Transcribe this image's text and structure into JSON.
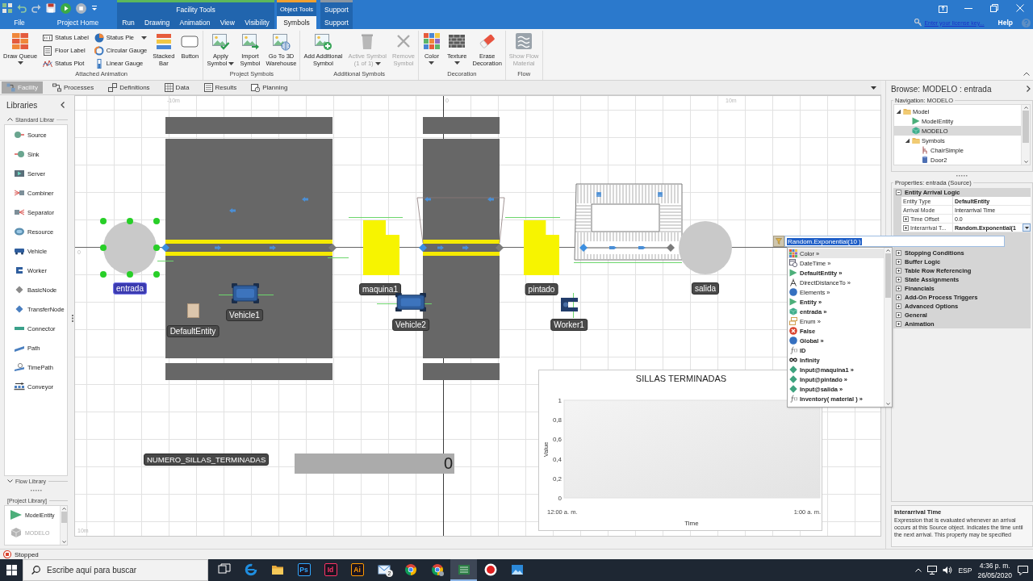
{
  "title_bar": {
    "tabs": [
      {
        "label": "File",
        "selected": false
      },
      {
        "label": "Project Home",
        "selected": false
      }
    ],
    "context_groups": [
      {
        "label": "Facility Tools",
        "color": "#5cb85c",
        "tabs": [
          {
            "label": "Run",
            "selected": false
          },
          {
            "label": "Drawing",
            "selected": false
          },
          {
            "label": "Animation",
            "selected": false
          },
          {
            "label": "View",
            "selected": false
          },
          {
            "label": "Visibility",
            "selected": false
          }
        ]
      },
      {
        "label": "Object Tools",
        "color": "#f0a030",
        "tabs": [
          {
            "label": "Symbols",
            "selected": true
          }
        ]
      },
      {
        "label": "Support",
        "color": "#8a96a3",
        "tabs": [
          {
            "label": "Support",
            "selected": false
          }
        ]
      }
    ],
    "license_link": "Enter your license key...",
    "help": "Help"
  },
  "ribbon": {
    "groups": [
      {
        "label": "Attached Animation",
        "items": [
          {
            "label": "Draw Queue",
            "kind": "large",
            "dropdown": true,
            "disabled": false
          },
          {
            "label": "Status Label",
            "kind": "small",
            "dropdown": false,
            "disabled": false
          },
          {
            "label": "Floor Label",
            "kind": "small",
            "dropdown": false,
            "disabled": false
          },
          {
            "label": "Status Plot",
            "kind": "small",
            "dropdown": false,
            "disabled": false
          },
          {
            "label": "Status Pie",
            "kind": "small",
            "dropdown": true,
            "disabled": false
          },
          {
            "label": "Circular Gauge",
            "kind": "small",
            "dropdown": false,
            "disabled": false
          },
          {
            "label": "Linear Gauge",
            "kind": "small",
            "dropdown": false,
            "disabled": false
          },
          {
            "label": "Stacked\nBar",
            "kind": "large",
            "dropdown": false,
            "disabled": false
          },
          {
            "label": "Button",
            "kind": "large",
            "dropdown": false,
            "disabled": false
          }
        ]
      },
      {
        "label": "Project Symbols",
        "items": [
          {
            "label": "Apply\nSymbol",
            "kind": "large",
            "dropdown": true,
            "disabled": false
          },
          {
            "label": "Import\nSymbol",
            "kind": "large",
            "dropdown": false,
            "disabled": false
          },
          {
            "label": "Go To 3D\nWarehouse",
            "kind": "large",
            "dropdown": false,
            "disabled": false
          }
        ]
      },
      {
        "label": "Additional Symbols",
        "items": [
          {
            "label": "Add Additional\nSymbol",
            "kind": "large",
            "dropdown": false,
            "disabled": false
          },
          {
            "label": "Active Symbol\n(1 of 1)",
            "kind": "large",
            "dropdown": true,
            "disabled": true
          },
          {
            "label": "Remove\nSymbol",
            "kind": "large",
            "dropdown": false,
            "disabled": true
          }
        ]
      },
      {
        "label": "Decoration",
        "items": [
          {
            "label": "Color",
            "kind": "large",
            "dropdown": true,
            "disabled": false
          },
          {
            "label": "Texture",
            "kind": "large",
            "dropdown": true,
            "disabled": false
          },
          {
            "label": "Erase\nDecoration",
            "kind": "large",
            "dropdown": false,
            "disabled": false
          }
        ]
      },
      {
        "label": "Flow",
        "items": [
          {
            "label": "Show Flow\nMaterial",
            "kind": "large",
            "dropdown": false,
            "disabled": true
          }
        ]
      }
    ]
  },
  "view_tabs": [
    {
      "label": "Facility",
      "selected": true
    },
    {
      "label": "Processes",
      "selected": false
    },
    {
      "label": "Definitions",
      "selected": false
    },
    {
      "label": "Data",
      "selected": false
    },
    {
      "label": "Results",
      "selected": false
    },
    {
      "label": "Planning",
      "selected": false
    }
  ],
  "libraries": {
    "title": "Libraries",
    "groups": [
      {
        "title": "Standard Librar",
        "expanded": true,
        "items": [
          {
            "label": "Source",
            "kind": "source"
          },
          {
            "label": "Sink",
            "kind": "sink"
          },
          {
            "label": "Server",
            "kind": "server"
          },
          {
            "label": "Combiner",
            "kind": "combiner"
          },
          {
            "label": "Separator",
            "kind": "separator"
          },
          {
            "label": "Resource",
            "kind": "resource"
          },
          {
            "label": "Vehicle",
            "kind": "vehicle"
          },
          {
            "label": "Worker",
            "kind": "worker"
          },
          {
            "label": "BasicNode",
            "kind": "basicnode"
          },
          {
            "label": "TransferNode",
            "kind": "transfernode"
          },
          {
            "label": "Connector",
            "kind": "connector"
          },
          {
            "label": "Path",
            "kind": "path"
          },
          {
            "label": "TimePath",
            "kind": "timepath"
          },
          {
            "label": "Conveyor",
            "kind": "conveyor"
          }
        ]
      },
      {
        "title": "Flow Library",
        "expanded": false
      }
    ],
    "project": {
      "title": "[Project Library]",
      "items": [
        {
          "label": "ModelEntity",
          "kind": "entity",
          "disabled": false
        },
        {
          "label": "MODELO",
          "kind": "model",
          "disabled": true
        }
      ]
    }
  },
  "canvas": {
    "ruler_labels": [
      "-10m",
      "0",
      "10m",
      "0",
      "10m"
    ],
    "objects": [
      {
        "kind": "source",
        "label": "entrada",
        "selected": true
      },
      {
        "kind": "entity",
        "label": "DefaultEntity",
        "selected": false
      },
      {
        "kind": "vehicle",
        "label": "Vehicle1",
        "selected": false
      },
      {
        "kind": "server",
        "label": "maquina1",
        "selected": false
      },
      {
        "kind": "vehicle",
        "label": "Vehicle2",
        "selected": false
      },
      {
        "kind": "server",
        "label": "pintado",
        "selected": false
      },
      {
        "kind": "worker",
        "label": "Worker1",
        "selected": false
      },
      {
        "kind": "sink",
        "label": "salida",
        "selected": false
      }
    ],
    "status_label": "NUMERO_SILLAS_TERMINADAS",
    "status_display": "0",
    "chart_data": {
      "type": "line",
      "title": "SILLAS TERMINADAS",
      "xlabel": "Time",
      "ylabel": "Value",
      "categories": [
        "12:00 a. m.",
        "1:00 a. m."
      ],
      "ylim": [
        0,
        1
      ],
      "yticks": [
        {
          "value": 0,
          "label": "0"
        },
        {
          "value": 0.2,
          "label": "0,2"
        },
        {
          "value": 0.4,
          "label": "0,4"
        },
        {
          "value": 0.6,
          "label": "0,6"
        },
        {
          "value": 0.8,
          "label": "0,8"
        },
        {
          "value": 1,
          "label": "1"
        }
      ]
    }
  },
  "expression_editor": {
    "value": "Random.Exponential(10 )",
    "suggestions": [
      {
        "label": "Color »",
        "kind": "palette",
        "selected": true
      },
      {
        "label": "DateTime »",
        "kind": "datetime",
        "selected": false
      },
      {
        "label": "DefaultEntity »",
        "kind": "entity",
        "selected": false
      },
      {
        "label": "DirectDistanceTo »",
        "kind": "distance",
        "selected": false
      },
      {
        "label": "Elements »",
        "kind": "elements",
        "selected": false
      },
      {
        "label": "Entity »",
        "kind": "entity",
        "selected": false
      },
      {
        "label": "entrada »",
        "kind": "object",
        "selected": false
      },
      {
        "label": "Enum »",
        "kind": "enum",
        "selected": false
      },
      {
        "label": "False",
        "kind": "false",
        "selected": false
      },
      {
        "label": "Global »",
        "kind": "global",
        "selected": false
      },
      {
        "label": "ID",
        "kind": "function",
        "selected": false
      },
      {
        "label": "Infinity",
        "kind": "infinity",
        "selected": false
      },
      {
        "label": "Input@maquina1 »",
        "kind": "node",
        "selected": false
      },
      {
        "label": "Input@pintado »",
        "kind": "node",
        "selected": false
      },
      {
        "label": "Input@salida »",
        "kind": "node",
        "selected": false
      },
      {
        "label": "Inventory( material ) »",
        "kind": "function",
        "selected": false
      }
    ]
  },
  "browser": {
    "title": "Browse: MODELO : entrada",
    "navigation": {
      "title": "Navigation: MODELO",
      "tree": [
        {
          "label": "Model",
          "kind": "folder",
          "expanded": true,
          "selected": false,
          "children": [
            {
              "label": "ModelEntity",
              "kind": "entity",
              "selected": false
            },
            {
              "label": "MODELO",
              "kind": "model",
              "selected": true
            },
            {
              "label": "Symbols",
              "kind": "folder",
              "expanded": true,
              "selected": false,
              "children": [
                {
                  "label": "ChairSimple",
                  "kind": "chair",
                  "selected": false
                },
                {
                  "label": "Door2",
                  "kind": "door",
                  "selected": false
                }
              ]
            }
          ]
        }
      ]
    },
    "properties": {
      "title": "Properties: entrada (Source)",
      "categories": [
        {
          "label": "Entity Arrival Logic",
          "expanded": true,
          "rows": [
            {
              "name": "Entity Type",
              "value": "DefaultEntity",
              "modified": true,
              "expandable": false,
              "editing": false
            },
            {
              "name": "Arrival Mode",
              "value": "Interarrival Time",
              "modified": false,
              "expandable": false,
              "editing": false
            },
            {
              "name": "Time Offset",
              "value": "0.0",
              "modified": false,
              "expandable": true,
              "editing": false
            },
            {
              "name": "Interarrival T...",
              "value": "Random.Exponential(1",
              "modified": true,
              "expandable": true,
              "editing": true
            }
          ]
        },
        {
          "label": "Stopping Conditions",
          "expanded": false
        },
        {
          "label": "Buffer Logic",
          "expanded": false
        },
        {
          "label": "Table Row Referencing",
          "expanded": false
        },
        {
          "label": "State Assignments",
          "expanded": false
        },
        {
          "label": "Financials",
          "expanded": false
        },
        {
          "label": "Add-On Process Triggers",
          "expanded": false
        },
        {
          "label": "Advanced Options",
          "expanded": false
        },
        {
          "label": "General",
          "expanded": false
        },
        {
          "label": "Animation",
          "expanded": false
        }
      ]
    },
    "description": {
      "title": "Interarrival Time",
      "text": "Expression that is evaluated whenever an arrival occurs at this Source object. Indicates the time until the next arrival. This property may be specified"
    }
  },
  "status_bar": {
    "text": "Stopped"
  },
  "taskbar": {
    "search": {
      "placeholder": "Escribe aquí para buscar"
    },
    "apps": [
      {
        "kind": "task-view",
        "active": false
      },
      {
        "kind": "browser-e",
        "active": false
      },
      {
        "kind": "folder",
        "active": false
      },
      {
        "kind": "tile",
        "label": "Ps",
        "color": "#31a8ff",
        "active": false
      },
      {
        "kind": "tile",
        "label": "Id",
        "color": "#ff3366",
        "active": false
      },
      {
        "kind": "tile",
        "label": "Ai",
        "color": "#ff9a00",
        "active": false
      },
      {
        "kind": "mail",
        "badge": "2",
        "active": false
      },
      {
        "kind": "browser-round",
        "active": false
      },
      {
        "kind": "browser-round-alt",
        "active": false
      },
      {
        "kind": "app-window",
        "active": true
      },
      {
        "kind": "record",
        "active": false
      },
      {
        "kind": "picture",
        "active": false
      }
    ],
    "tray": {
      "language": "ESP",
      "time": "4:36 p. m.",
      "date": "26/05/2020"
    }
  }
}
